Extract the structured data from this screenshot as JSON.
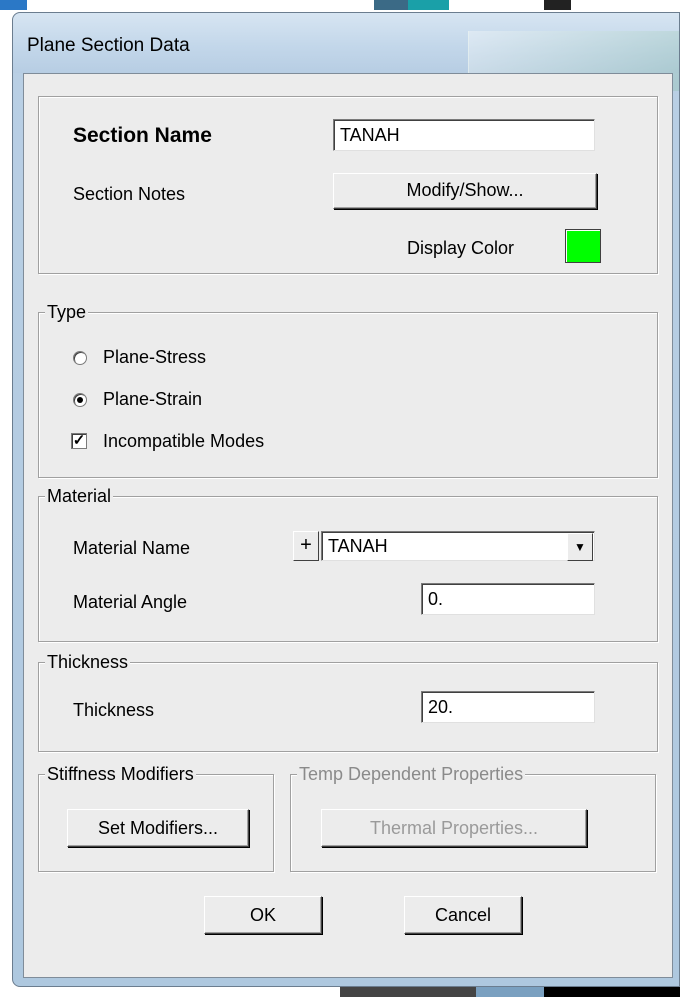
{
  "dialog": {
    "title": "Plane Section Data"
  },
  "section": {
    "name_label": "Section Name",
    "name_value": "TANAH",
    "notes_label": "Section Notes",
    "modify_button": "Modify/Show...",
    "display_color_label": "Display Color",
    "display_color": "#00ff00"
  },
  "type_group": {
    "legend": "Type",
    "plane_stress": "Plane-Stress",
    "plane_strain": "Plane-Strain",
    "selected": "Plane-Strain",
    "incompatible_modes": "Incompatible Modes",
    "incompatible_checked": true
  },
  "material_group": {
    "legend": "Material",
    "name_label": "Material Name",
    "plus_label": "+",
    "name_value": "TANAH",
    "angle_label": "Material Angle",
    "angle_value": "0."
  },
  "thickness_group": {
    "legend": "Thickness",
    "label": "Thickness",
    "value": "20."
  },
  "stiffness_group": {
    "legend": "Stiffness Modifiers",
    "button": "Set Modifiers..."
  },
  "temp_group": {
    "legend": "Temp Dependent Properties",
    "button": "Thermal Properties..."
  },
  "buttons": {
    "ok": "OK",
    "cancel": "Cancel"
  }
}
